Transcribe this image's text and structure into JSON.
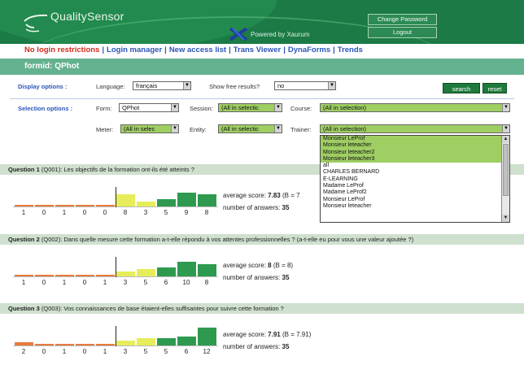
{
  "header": {
    "logo_text": "QualitySensor",
    "powered_by": "Powered by Xaurum",
    "change_password": "Change Password",
    "logout": "Logout"
  },
  "nav": {
    "items": [
      "No login restrictions",
      "Login manager",
      "New access list",
      "Trans Viewer",
      "DynaForms",
      "Trends"
    ]
  },
  "formbar": {
    "title": "formid: QPhot"
  },
  "display_options": {
    "label": "Display options :",
    "language_label": "Language:",
    "language_value": "français",
    "free_results_label": "Show free results?",
    "free_results_value": "no",
    "search_button": "search",
    "reset_button": "reset"
  },
  "selection_options": {
    "label": "Selection options :",
    "form_label": "Form:",
    "form_value": "QPhot",
    "session_label": "Session:",
    "session_value": "(All in selectic",
    "course_label": "Course:",
    "course_value": "(All in selection)",
    "meter_label": "Meter:",
    "meter_value": "(All in selec",
    "entity_label": "Entity:",
    "entity_value": "(All in selectic",
    "trainer_label": "Trainer:",
    "trainer_value": "(All in selection)",
    "trainer_options": [
      "Monsieur LeProf",
      "Monsieur leteacher",
      "Monsieur leteacher2",
      "Monsieur leteacher3",
      "all",
      "CHARLES BERNARD",
      "E-LEARNING",
      "Madame LeProf",
      "Madame LeProf2",
      "Monsieur LeProf",
      "Monsieur leteacher"
    ]
  },
  "colors": {
    "header_green": "#1b7a45",
    "formbar_green": "#63b18f",
    "selected_green": "#9fce63",
    "nav_blue": "#2a55b8",
    "nav_red": "#d22a1d",
    "bar_orange": "#e87a3c",
    "bar_yellow": "#e7ec5a",
    "bar_green": "#2e9a4f"
  },
  "questions": [
    {
      "heading_prefix": "Question 1",
      "heading_text": "(Q001): Les objectifs de la formation ont-ils été atteints ?",
      "counts": [
        "1",
        "0",
        "1",
        "0",
        "0",
        "8",
        "3",
        "5",
        "9",
        "8"
      ],
      "avg_label": "average score:",
      "avg_value": "7.83",
      "avg_extra": "(B = 7",
      "answers_label": "number of answers:",
      "answers_value": "35"
    },
    {
      "heading_prefix": "Question 2",
      "heading_text": "(Q002): Dans quelle mesure cette formation a-t-elle répondu à vos attentes professionnelles ? (a-t-elle eu pour vous une valeur ajoutée ?)",
      "counts": [
        "1",
        "0",
        "1",
        "0",
        "1",
        "3",
        "5",
        "6",
        "10",
        "8"
      ],
      "avg_label": "average score:",
      "avg_value": "8",
      "avg_extra": "(B = 8)",
      "answers_label": "number of answers:",
      "answers_value": "35"
    },
    {
      "heading_prefix": "Question 3",
      "heading_text": "(Q003): Vos connaissances de base étaient-elles suffisantes pour suivre cette formation ?",
      "counts": [
        "2",
        "0",
        "1",
        "0",
        "1",
        "3",
        "5",
        "5",
        "6",
        "12"
      ],
      "avg_label": "average score:",
      "avg_value": "7.91",
      "avg_extra": "(B = 7.91)",
      "answers_label": "number of answers:",
      "answers_value": "35"
    }
  ]
}
